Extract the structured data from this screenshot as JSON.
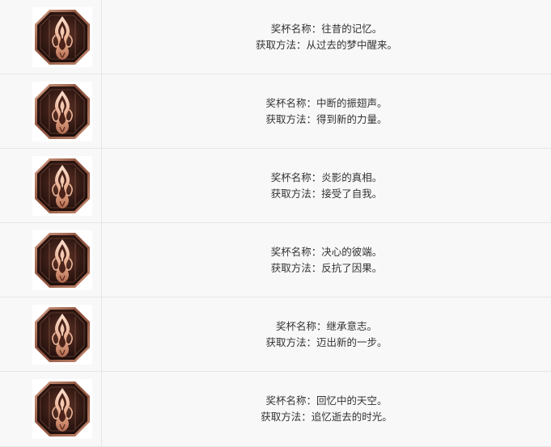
{
  "trophies": [
    {
      "name_label": "奖杯名称：",
      "name": "往昔的记忆。",
      "method_label": "获取方法：",
      "method": "从过去的梦中醒来。",
      "icon": "bronze-trophy-icon"
    },
    {
      "name_label": "奖杯名称：",
      "name": "中断的振翅声。",
      "method_label": "获取方法：",
      "method": "得到新的力量。",
      "icon": "bronze-trophy-icon"
    },
    {
      "name_label": "奖杯名称：",
      "name": "炎影的真相。",
      "method_label": "获取方法：",
      "method": "接受了自我。",
      "icon": "bronze-trophy-icon"
    },
    {
      "name_label": "奖杯名称：",
      "name": "决心的彼端。",
      "method_label": "获取方法：",
      "method": "反抗了因果。",
      "icon": "bronze-trophy-icon"
    },
    {
      "name_label": "奖杯名称：",
      "name": "继承意志。",
      "method_label": "获取方法：",
      "method": "迈出新的一步。",
      "icon": "bronze-trophy-icon"
    },
    {
      "name_label": "奖杯名称：",
      "name": "回忆中的天空。",
      "method_label": "获取方法：",
      "method": "追忆逝去的时光。",
      "icon": "bronze-trophy-icon"
    }
  ],
  "colors": {
    "trophy_dark": "#2a1410",
    "trophy_mid": "#6b3a2c",
    "trophy_light": "#f0c4a8",
    "row_bg": "#f8f8f8",
    "border": "#e6e6e6"
  }
}
